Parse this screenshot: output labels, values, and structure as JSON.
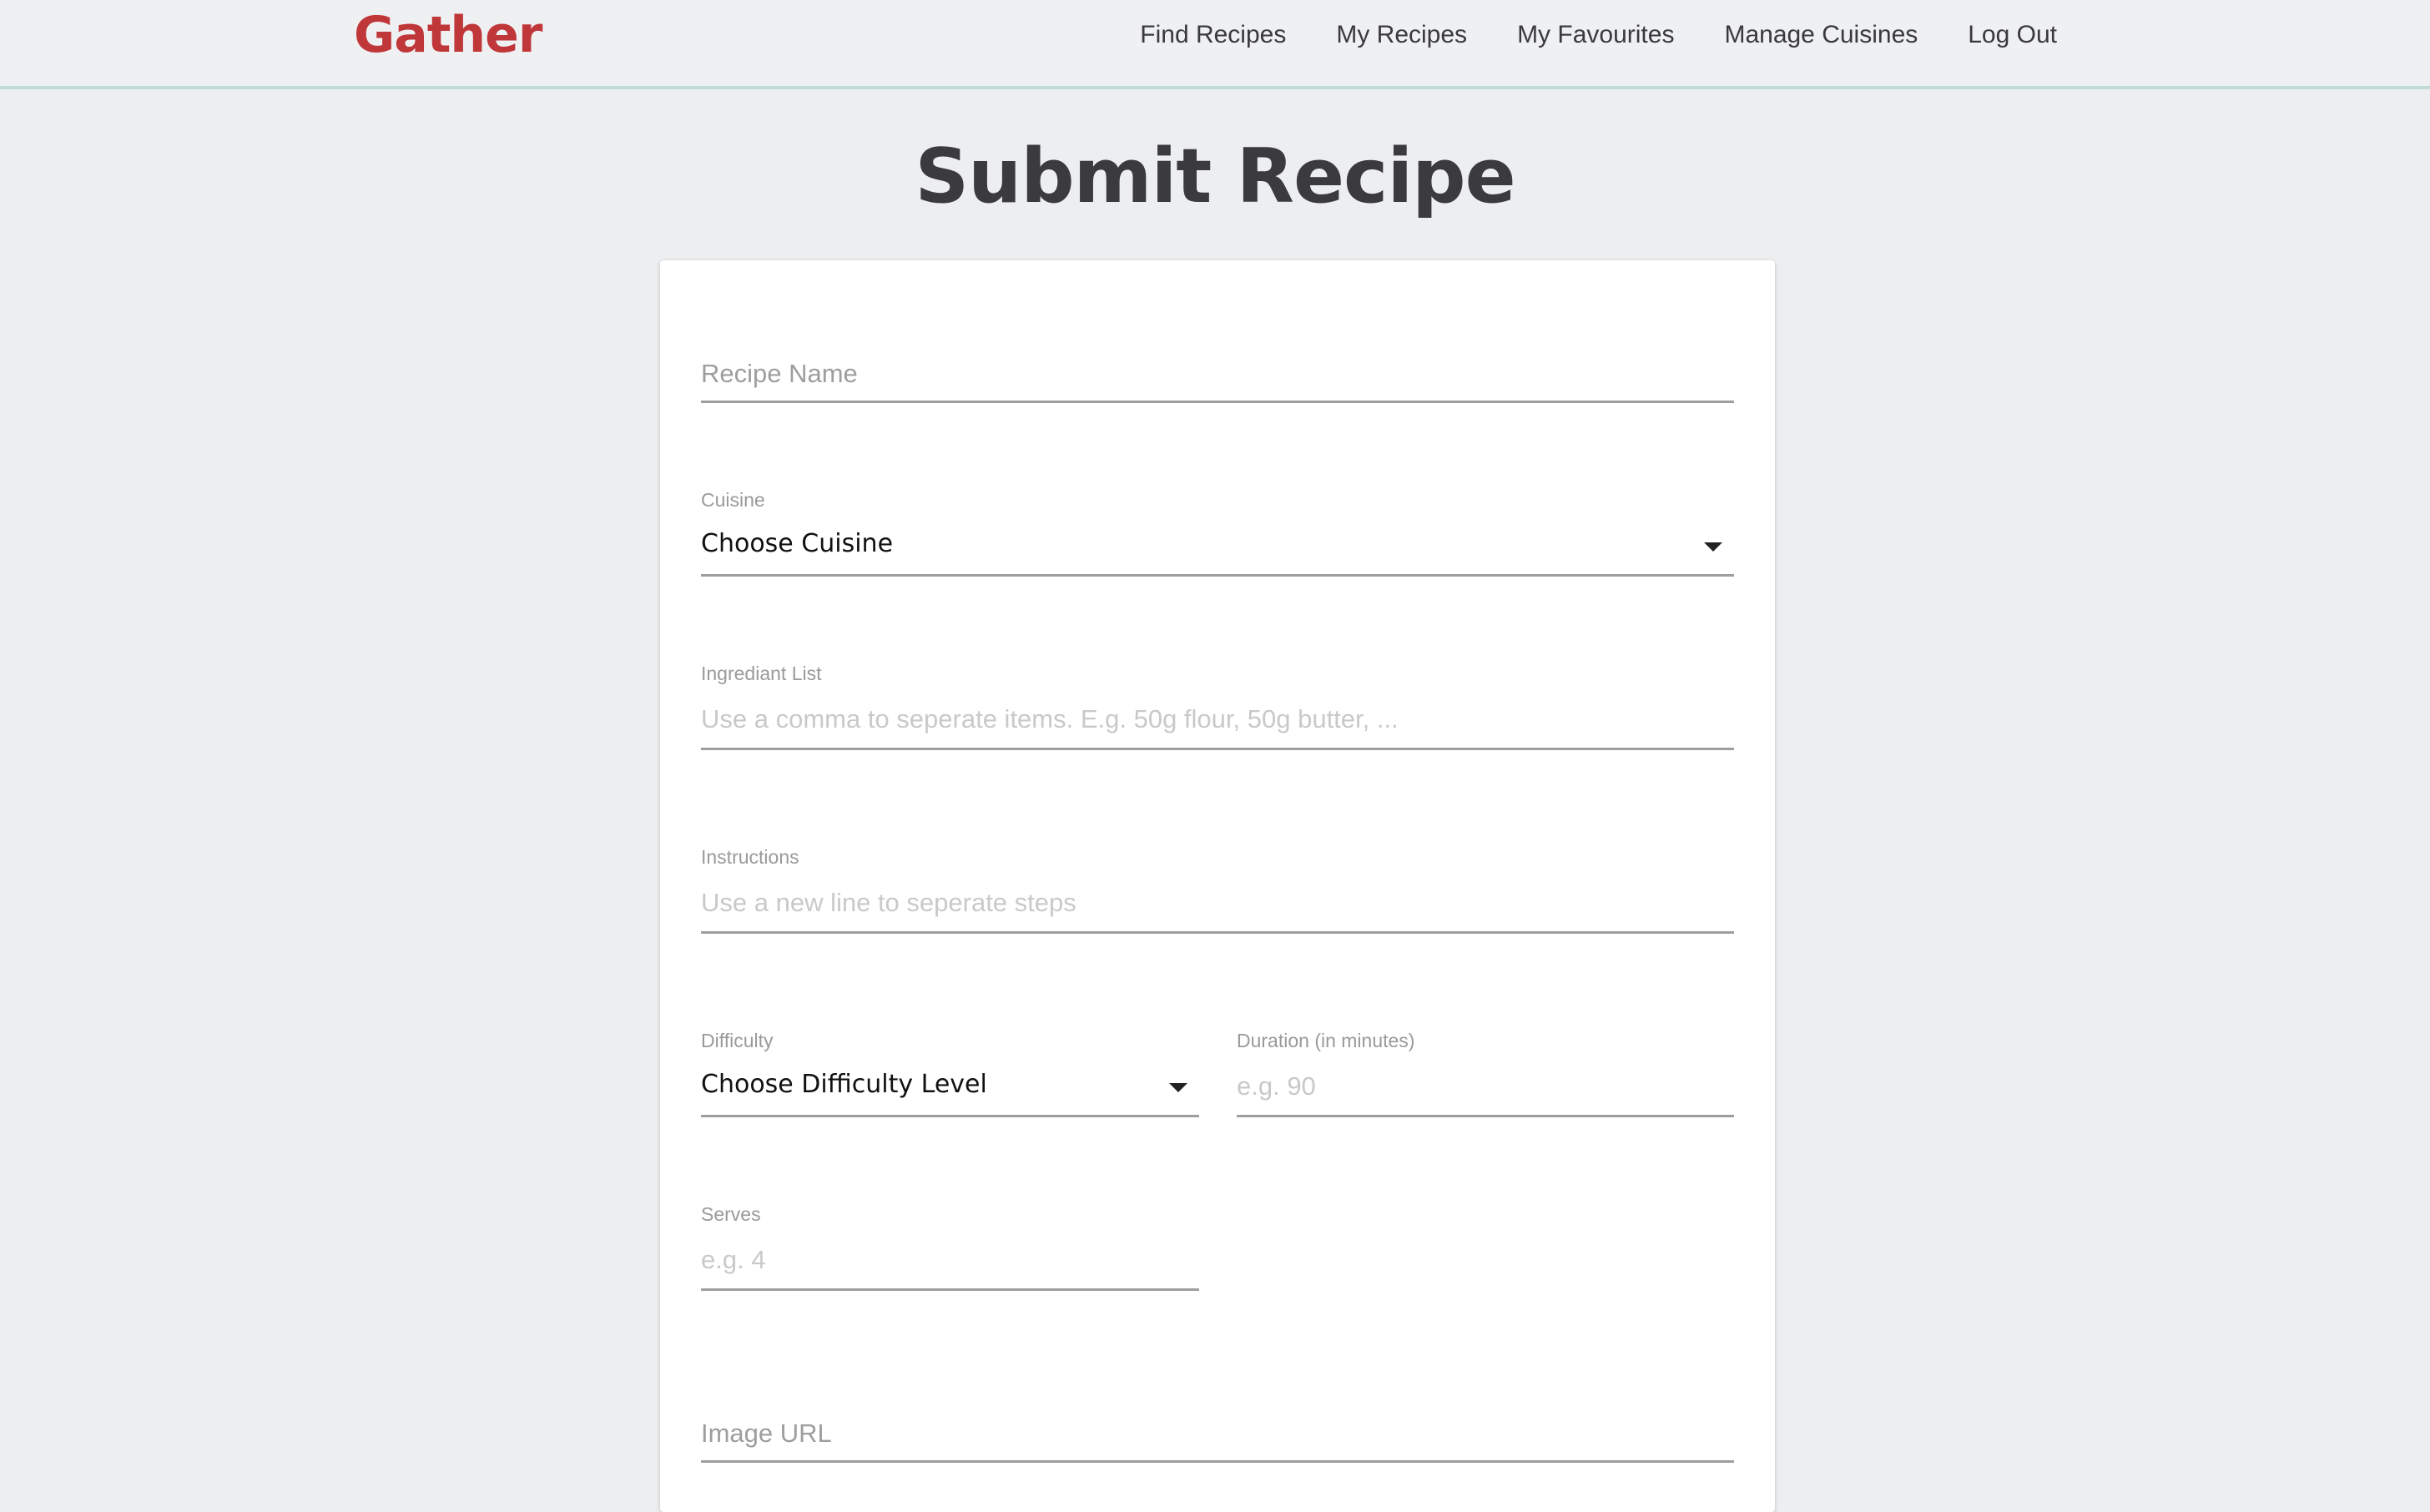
{
  "navbar": {
    "brand": "Gather",
    "links": [
      {
        "label": "Find Recipes"
      },
      {
        "label": "My Recipes"
      },
      {
        "label": "My Favourites"
      },
      {
        "label": "Manage Cuisines"
      },
      {
        "label": "Log Out"
      }
    ]
  },
  "page": {
    "title": "Submit Recipe"
  },
  "form": {
    "recipe_name": {
      "placeholder": "Recipe Name",
      "value": ""
    },
    "cuisine": {
      "label": "Cuisine",
      "selected": "Choose Cuisine"
    },
    "ingredients": {
      "label": "Ingrediant List",
      "placeholder": "Use a comma to seperate items. E.g. 50g flour, 50g butter, ...",
      "value": ""
    },
    "instructions": {
      "label": "Instructions",
      "placeholder": "Use a new line to seperate steps",
      "value": ""
    },
    "difficulty": {
      "label": "Difficulty",
      "selected": "Choose Difficulty Level"
    },
    "duration": {
      "label": "Duration (in minutes)",
      "placeholder": "e.g. 90",
      "value": ""
    },
    "serves": {
      "label": "Serves",
      "placeholder": "e.g. 4",
      "value": ""
    },
    "image_url": {
      "placeholder": "Image URL",
      "value": ""
    }
  },
  "colors": {
    "brand": "#c0373a",
    "nav_border": "#c1dcd6",
    "background": "#edeef0"
  }
}
